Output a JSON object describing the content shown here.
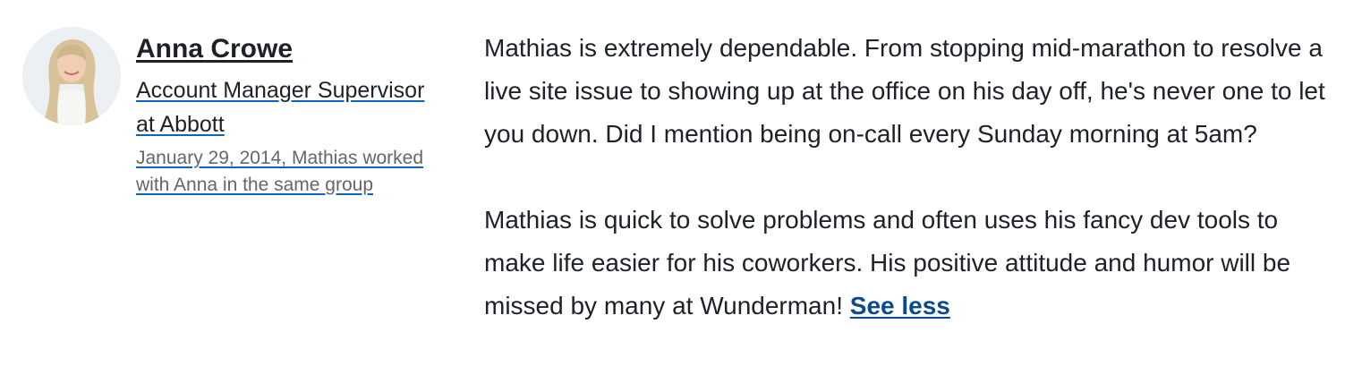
{
  "recommender": {
    "name": "Anna Crowe",
    "headline": "Account Manager Supervisor at Abbott",
    "relationship": "January 29, 2014, Mathias worked with Anna in the same group"
  },
  "recommendation": {
    "paragraphs": [
      "Mathias is extremely dependable. From stopping mid-marathon to resolve a live site issue to showing up at the office on his day off, he's never one to let you down. Did I mention being on-call every Sunday morning at 5am?",
      "Mathias is quick to solve problems and often uses his fancy dev tools to make life easier for his coworkers. His positive attitude and humor will be missed by many at Wunderman!"
    ],
    "toggle_label": "See less"
  },
  "colors": {
    "text": "#1d2226",
    "muted": "#666666",
    "link": "#0a4a8f",
    "underline": "#0a66c2"
  }
}
